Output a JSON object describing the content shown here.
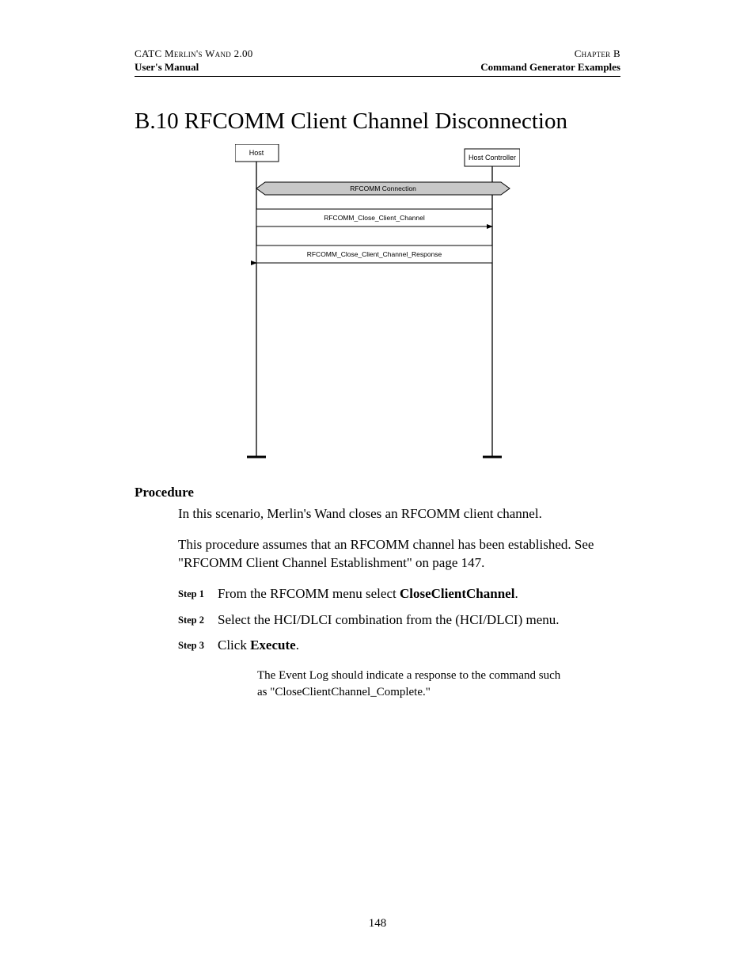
{
  "header": {
    "left_top": "CATC Merlin's Wand 2.00",
    "right_top": "Chapter B",
    "left_bottom": "User's Manual",
    "right_bottom": "Command Generator Examples"
  },
  "section_title": "B.10  RFCOMM Client Channel Disconnection",
  "diagram": {
    "host_label": "Host",
    "controller_label": "Host Controller",
    "band_label": "RFCOMM Connection",
    "msg1": "RFCOMM_Close_Client_Channel",
    "msg2": "RFCOMM_Close_Client_Channel_Response"
  },
  "procedure_heading": "Procedure",
  "intro1": "In this scenario, Merlin's Wand closes an RFCOMM client channel.",
  "intro2": "This procedure assumes that an RFCOMM channel has been established. See \"RFCOMM Client Channel Establishment\" on page 147.",
  "steps": [
    {
      "label": "Step 1",
      "pre": "From the RFCOMM menu select ",
      "bold": "CloseClientChannel",
      "post": "."
    },
    {
      "label": "Step 2",
      "pre": "Select the HCI/DLCI combination from the (HCI/DLCI) menu.",
      "bold": "",
      "post": ""
    },
    {
      "label": "Step 3",
      "pre": "Click ",
      "bold": "Execute",
      "post": "."
    }
  ],
  "note": "The Event Log should indicate a response to the command such as \"CloseClientChannel_Complete.\"",
  "page_number": "148"
}
